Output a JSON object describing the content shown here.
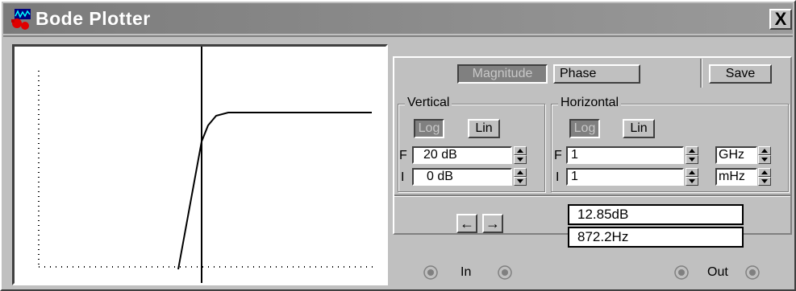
{
  "window": {
    "title": "Bode Plotter",
    "close_label": "X"
  },
  "mode_buttons": {
    "magnitude": "Magnitude",
    "phase": "Phase",
    "save": "Save"
  },
  "vertical": {
    "label": "Vertical",
    "log_label": "Log",
    "lin_label": "Lin",
    "final_letter": "F",
    "initial_letter": "I",
    "final_value": "20 dB",
    "initial_value": "0 dB"
  },
  "horizontal": {
    "label": "Horizontal",
    "log_label": "Log",
    "lin_label": "Lin",
    "final_letter": "F",
    "initial_letter": "I",
    "final_value": "1",
    "initial_value": "1",
    "final_unit": "GHz",
    "initial_unit": "mHz"
  },
  "readout": {
    "magnitude": "12.85dB",
    "frequency": "872.2Hz"
  },
  "cursor_arrows": {
    "left": "←",
    "right": "→"
  },
  "terminals": {
    "in_label": "In",
    "out_label": "Out"
  },
  "colors": {
    "window_bg": "#c0c0c0",
    "titlebar": "#8a8a8a",
    "pressed_button": "#808080",
    "plot_bg": "#ffffff"
  }
}
